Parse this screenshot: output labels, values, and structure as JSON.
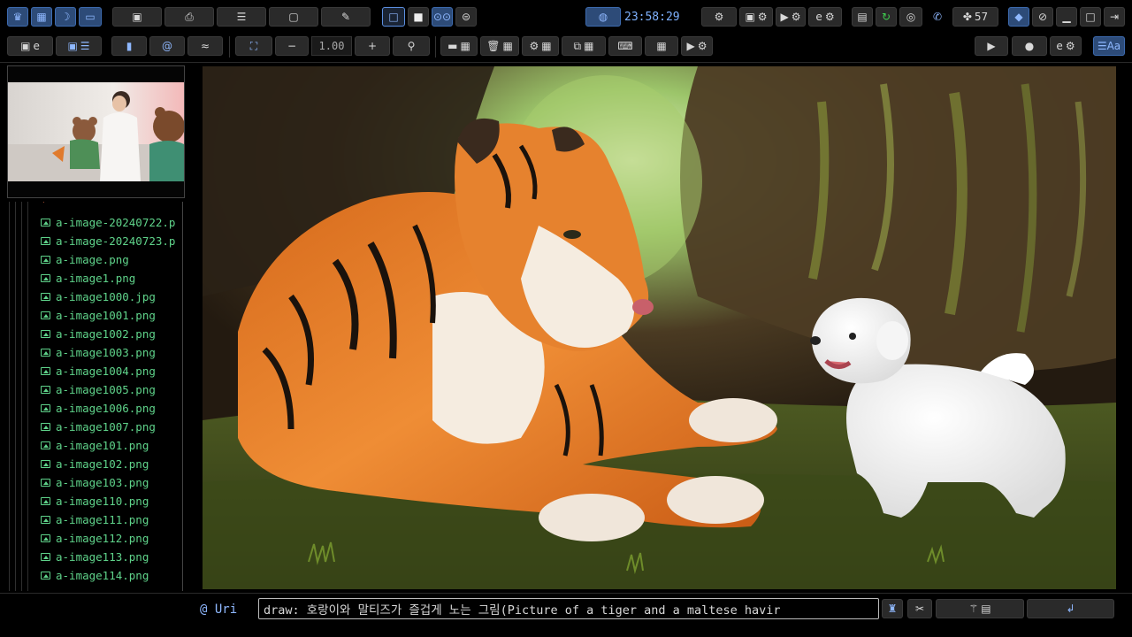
{
  "toolbar_row1": {
    "status_clock": "23:58:29",
    "indicator_count": "57"
  },
  "toolbar_row2": {
    "zoom_value": "1.00"
  },
  "file_tree": {
    "items": [
      "a-image-20240722.p",
      "a-image-20240723.p",
      "a-image.png",
      "a-image1.png",
      "a-image1000.jpg",
      "a-image1001.png",
      "a-image1002.png",
      "a-image1003.png",
      "a-image1004.png",
      "a-image1005.png",
      "a-image1006.png",
      "a-image1007.png",
      "a-image101.png",
      "a-image102.png",
      "a-image103.png",
      "a-image110.png",
      "a-image111.png",
      "a-image112.png",
      "a-image113.png",
      "a-image114.png"
    ]
  },
  "command_bar": {
    "uri_label": "@ Uri",
    "command_value": "draw: 호랑이와 말티즈가 즐겁게 노는 그림(Picture of a tiger and a maltese havir"
  },
  "colors": {
    "accent": "#5b8fe0",
    "file_green": "#5fd38a",
    "clock_blue": "#7fb2ff"
  }
}
